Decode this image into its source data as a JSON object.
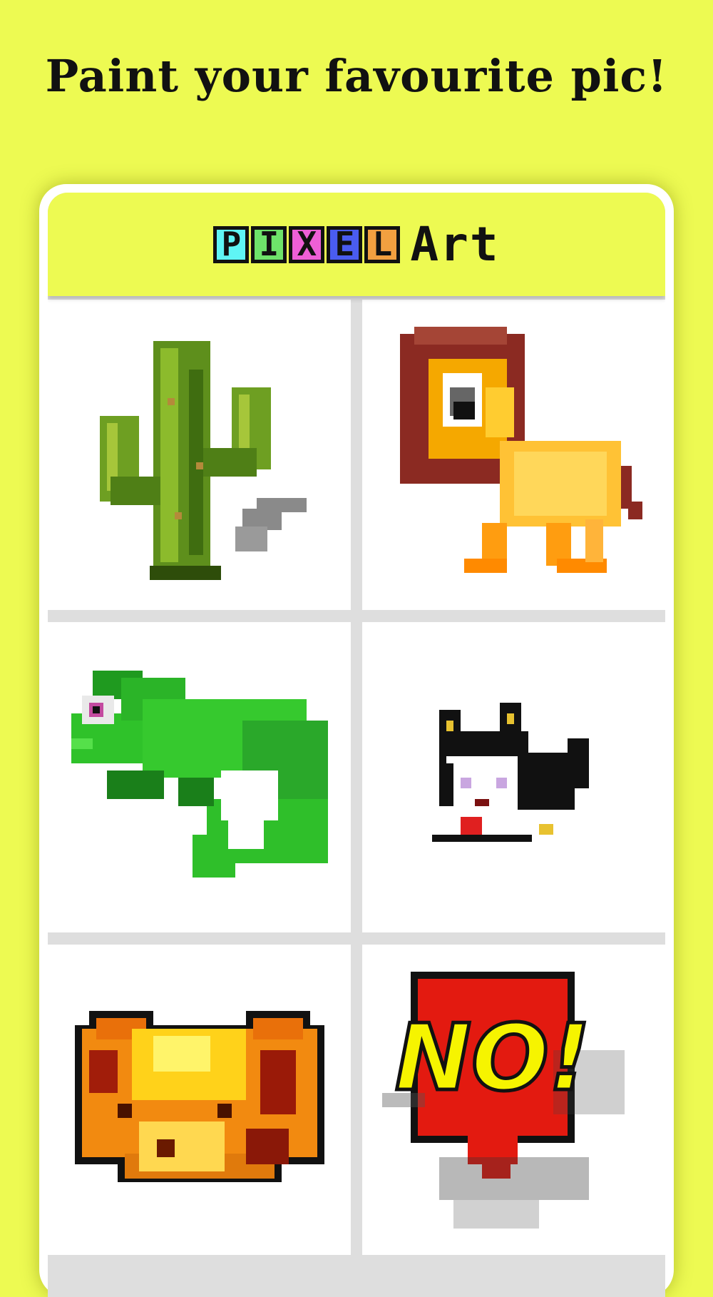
{
  "headline": "Paint your favourite pic!",
  "app": {
    "logo_letters": [
      "P",
      "I",
      "X",
      "E",
      "L"
    ],
    "logo_colors": [
      "#5ff5f5",
      "#6ee36a",
      "#ee5fd6",
      "#4a5cf0",
      "#f2a040"
    ],
    "logo_word": "Art"
  },
  "gallery": [
    {
      "name": "cactus"
    },
    {
      "name": "lion"
    },
    {
      "name": "chameleon"
    },
    {
      "name": "cat"
    },
    {
      "name": "bear"
    },
    {
      "name": "no-bubble",
      "text": "NO!"
    }
  ],
  "colors": {
    "background": "#edfa52",
    "card": "#ffffff",
    "divider": "#dedede"
  }
}
